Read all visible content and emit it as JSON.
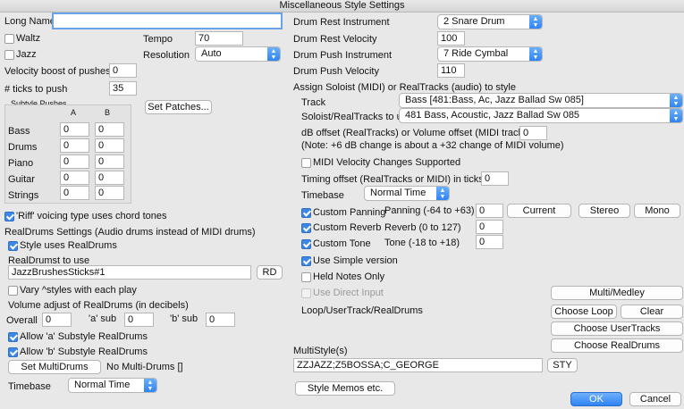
{
  "window": {
    "title": "Miscellaneous Style Settings"
  },
  "left": {
    "long_name_label": "Long Name",
    "long_name_value": "",
    "waltz_label": "Waltz",
    "jazz_label": "Jazz",
    "tempo_label": "Tempo",
    "tempo_value": "70",
    "resolution_label": "Resolution",
    "resolution_value": "Auto",
    "velocity_boost_label": "Velocity boost of pushes",
    "velocity_boost_value": "0",
    "ticks_label": "# ticks to push",
    "ticks_value": "35",
    "subtyle_pushes_label": "Subtyle Pushes",
    "col_a": "A",
    "col_b": "B",
    "set_patches_label": "Set Patches...",
    "pushes": [
      {
        "name": "Bass",
        "a": "0",
        "b": "0"
      },
      {
        "name": "Drums",
        "a": "0",
        "b": "0"
      },
      {
        "name": "Piano",
        "a": "0",
        "b": "0"
      },
      {
        "name": "Guitar",
        "a": "0",
        "b": "0"
      },
      {
        "name": "Strings",
        "a": "0",
        "b": "0"
      }
    ],
    "riff_label": "'Riff' voicing type uses chord tones",
    "rd_settings_label": "RealDrums Settings (Audio drums instead of MIDI drums)",
    "style_uses_rd_label": "Style uses RealDrums",
    "rd_to_use_label": "RealDrumst to use",
    "rd_to_use_value": "JazzBrushesSticks#1",
    "rd_button": "RD",
    "vary_label": "Vary ^styles with each play",
    "volume_adjust_label": "Volume adjust of RealDrums (in decibels)",
    "overall_label": "Overall",
    "overall_value": "0",
    "a_sub_label": "'a' sub",
    "a_sub_value": "0",
    "b_sub_label": "'b' sub",
    "b_sub_value": "0",
    "allow_a_label": "Allow 'a' Substyle RealDrums",
    "allow_b_label": "Allow 'b' Substyle RealDrums",
    "set_multidrums_label": "Set MultiDrums",
    "no_multidrums_label": "No Multi-Drums []",
    "timebase_label": "Timebase",
    "timebase_value": "Normal Time"
  },
  "right": {
    "drum_rest_instr_label": "Drum Rest Instrument",
    "drum_rest_instr_value": "2 Snare Drum",
    "drum_rest_vel_label": "Drum Rest Velocity",
    "drum_rest_vel_value": "100",
    "drum_push_instr_label": "Drum Push Instrument",
    "drum_push_instr_value": "7 Ride Cymbal",
    "drum_push_vel_label": "Drum Push Velocity",
    "drum_push_vel_value": "110",
    "assign_label": "Assign Soloist (MIDI) or RealTracks (audio) to style",
    "track_label": "Track",
    "track_value": "Bass [481:Bass, Ac, Jazz Ballad Sw 085]",
    "soloist_label": "Soloist/RealTracks to use",
    "soloist_value": "481 Bass, Acoustic, Jazz Ballad Sw 085",
    "db_offset_label": "dB offset (RealTracks) or Volume offset (MIDI tracks)",
    "db_offset_value": "0",
    "db_note": "(Note: +6 dB change is about a +32 change of MIDI volume)",
    "midi_vel_label": "MIDI Velocity Changes Supported",
    "timing_offset_label": "Timing offset (RealTracks or MIDI) in ticks",
    "timing_offset_value": "0",
    "timebase_label": "Timebase",
    "timebase_value": "Normal Time",
    "custom_panning_label": "Custom Panning",
    "panning_label": "Panning (-64 to +63)",
    "panning_value": "0",
    "current_label": "Current",
    "stereo_label": "Stereo",
    "mono_label": "Mono",
    "custom_reverb_label": "Custom Reverb",
    "reverb_label": "Reverb (0 to 127)",
    "reverb_value": "0",
    "custom_tone_label": "Custom Tone",
    "tone_label": "Tone (-18 to +18)",
    "tone_value": "0",
    "simple_version_label": "Use Simple version",
    "held_notes_label": "Held Notes Only",
    "direct_input_label": "Use Direct Input",
    "multi_medley_label": "Multi/Medley",
    "loop_label": "Loop/UserTrack/RealDrums",
    "choose_loop_label": "Choose Loop",
    "clear_label": "Clear",
    "choose_usertracks_label": "Choose UserTracks",
    "choose_realdrums_label": "Choose RealDrums",
    "multistyle_label": "MultiStyle(s)",
    "multistyle_value": "ZZJAZZ;Z5BOSSA;C_GEORGE",
    "sty_label": "STY",
    "style_memos_label": "Style Memos etc.",
    "ok_label": "OK",
    "cancel_label": "Cancel"
  },
  "colors": {
    "accent": "#2f84f3",
    "background": "#e8e8e8"
  }
}
